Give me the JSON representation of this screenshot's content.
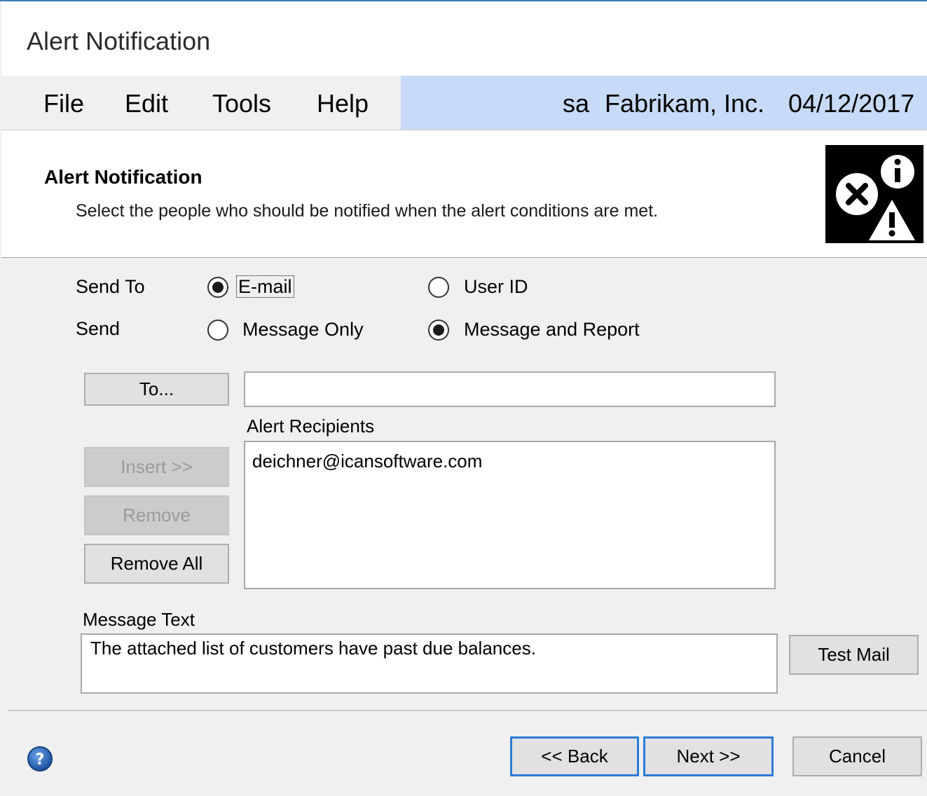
{
  "window": {
    "title": "Alert Notification"
  },
  "menu": {
    "items": [
      "File",
      "Edit",
      "Tools",
      "Help"
    ]
  },
  "user_bar": {
    "user": "sa",
    "company": "Fabrikam, Inc.",
    "date": "04/12/2017",
    "background": "#c7daf7"
  },
  "header": {
    "title": "Alert Notification",
    "description": "Select the people who should be notified when the alert conditions are met.",
    "icon": "alert-error-warning-info-icon"
  },
  "send_to": {
    "label": "Send To",
    "options": [
      {
        "label": "E-mail",
        "selected": true
      },
      {
        "label": "User ID",
        "selected": false
      }
    ]
  },
  "send": {
    "label": "Send",
    "options": [
      {
        "label": "Message Only",
        "selected": false
      },
      {
        "label": "Message and Report",
        "selected": true
      }
    ]
  },
  "to_button": {
    "label": "To...",
    "mnemonic": "o"
  },
  "to_field": {
    "value": ""
  },
  "recipients": {
    "label": "Alert Recipients",
    "items": [
      "deichner@icansoftware.com"
    ]
  },
  "buttons": {
    "insert": {
      "label": "Insert >>",
      "enabled": false
    },
    "remove": {
      "label": "Remove",
      "enabled": false
    },
    "remove_all": {
      "label": "Remove All",
      "enabled": true
    },
    "test_mail": {
      "label": "Test Mail"
    },
    "back": {
      "label": "<< Back"
    },
    "next": {
      "label": "Next >>"
    },
    "cancel": {
      "label": "Cancel"
    }
  },
  "message": {
    "label": "Message Text",
    "value": "The attached list of customers have past due balances."
  },
  "colors": {
    "accent": "#2b7bd6",
    "window_border": "#3c7fb1",
    "background": "#f0f0f0"
  }
}
